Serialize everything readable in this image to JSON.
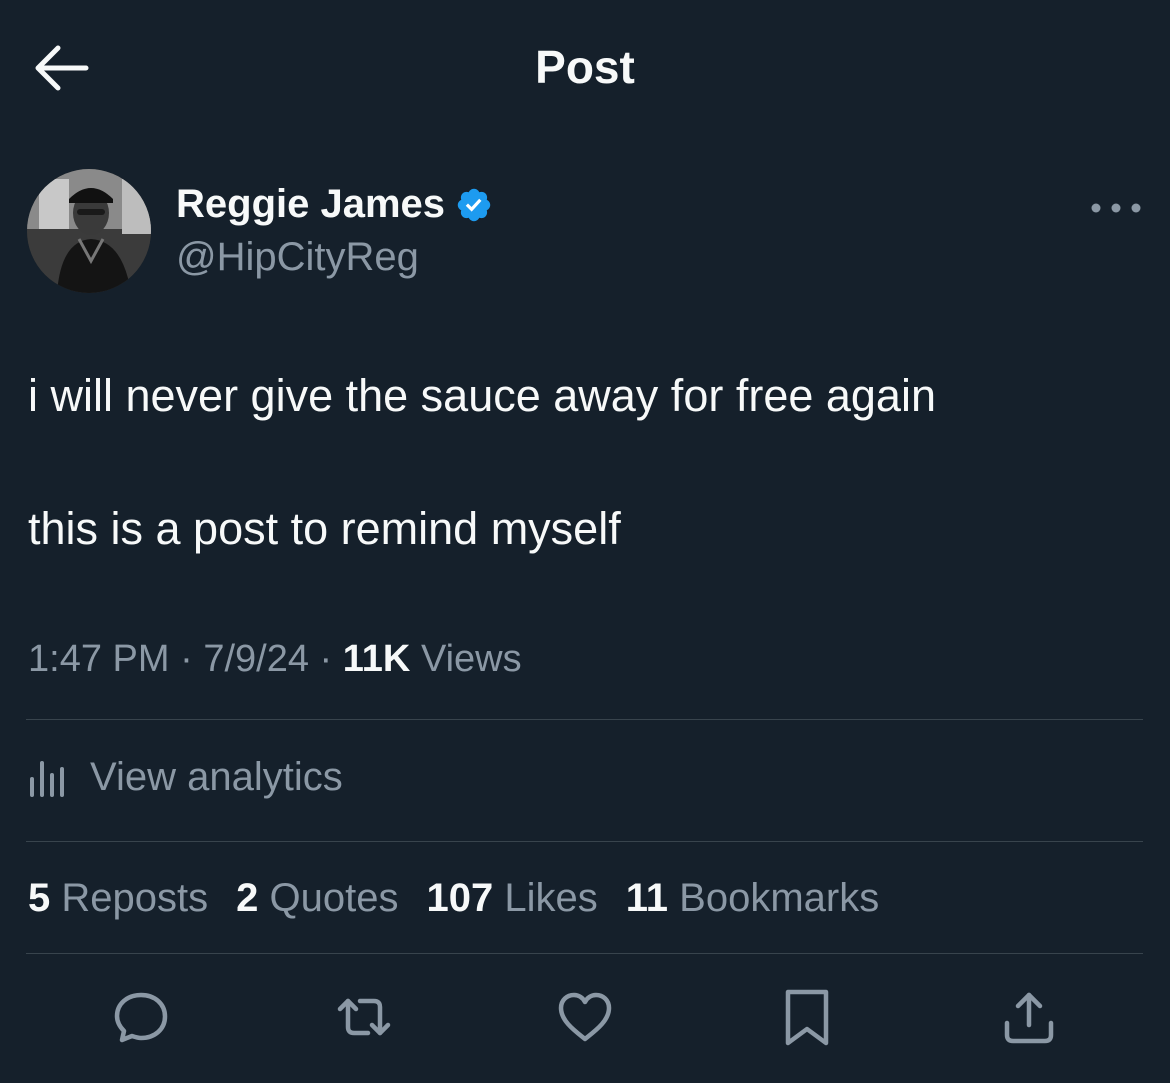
{
  "header": {
    "title": "Post"
  },
  "author": {
    "name": "Reggie James",
    "handle": "@HipCityReg",
    "verified": true
  },
  "post": {
    "lines": [
      "i will never give the sauce away for free again",
      "this is a post to remind myself"
    ],
    "time": "1:47 PM",
    "date": "7/9/24",
    "views_count": "11K",
    "views_label": "Views",
    "separator": "·"
  },
  "analytics": {
    "label": "View analytics"
  },
  "stats": [
    {
      "count": "5",
      "label": "Reposts"
    },
    {
      "count": "2",
      "label": "Quotes"
    },
    {
      "count": "107",
      "label": "Likes"
    },
    {
      "count": "11",
      "label": "Bookmarks"
    }
  ],
  "actions": [
    "reply-icon",
    "repost-icon",
    "like-icon",
    "bookmark-icon",
    "share-icon"
  ],
  "colors": {
    "background": "#15202b",
    "text_primary": "#f7f9f9",
    "text_secondary": "#8b98a5",
    "divider": "#38444d",
    "verified": "#1d9bf0"
  }
}
